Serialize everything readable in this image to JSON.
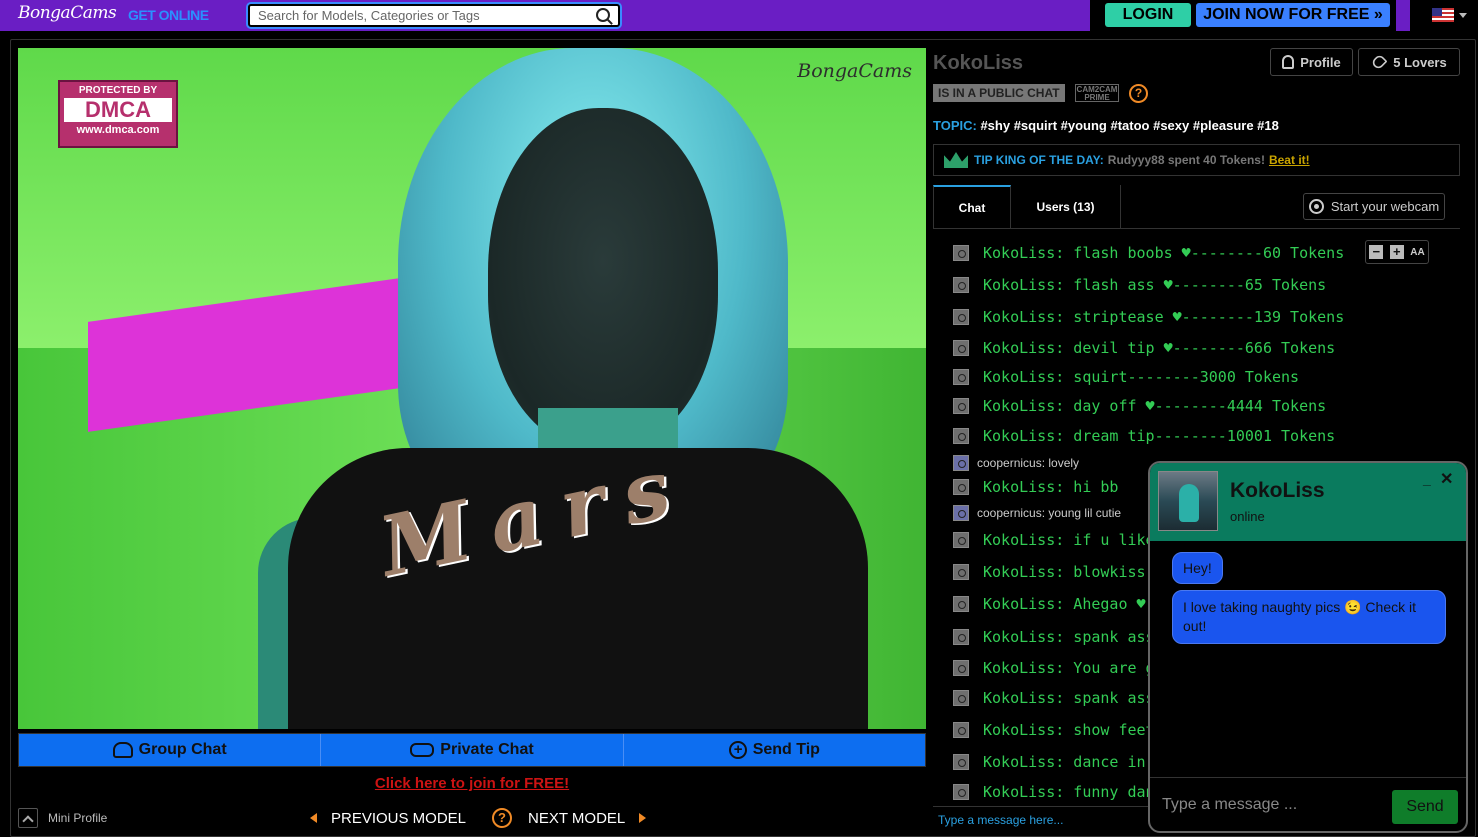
{
  "header": {
    "logo": "BongaCams",
    "online": "GET ONLINE",
    "search_placeholder": "Search for Models, Categories or Tags",
    "login": "LOGIN",
    "join": "JOIN NOW FOR FREE »"
  },
  "stream": {
    "dmca_protected": "PROTECTED BY",
    "dmca_big": "DMCA",
    "dmca_url": "www.dmca.com",
    "watermark": "BongaCams",
    "shirt_text": "Mars"
  },
  "controls": {
    "group_chat": "Group Chat",
    "private_chat": "Private Chat",
    "send_tip": "Send Tip",
    "join_free": "Click here to join for FREE!",
    "mini_profile": "Mini Profile",
    "previous_model": "PREVIOUS MODEL",
    "next_model": "NEXT MODEL",
    "help": "?"
  },
  "model": {
    "name": "KokoLiss",
    "profile": "Profile",
    "lovers": "5 Lovers",
    "status": "IS IN A PUBLIC CHAT",
    "prime": "CAM2CAM PRIME",
    "help": "?",
    "topic_label": "TOPIC:",
    "topic": "#shy #squirt #young #tatoo #sexy #pleasure #18"
  },
  "tipking": {
    "label": "TIP KING OF THE DAY:",
    "who": "Rudyyy88 spent 40 Tokens!",
    "beat": "Beat it!"
  },
  "tabs": {
    "chat": "Chat",
    "users": "Users (13)",
    "webcam": "Start your webcam"
  },
  "chat": {
    "zoom_minus": "−",
    "zoom_plus": "+",
    "zoom_label": "AA",
    "messages": [
      {
        "type": "model",
        "text": "KokoLiss: flash boobs ♥--------60 Tokens"
      },
      {
        "type": "model",
        "text": "KokoLiss: flash ass  ♥--------65 Tokens"
      },
      {
        "type": "model",
        "text": "KokoLiss: striptease ♥--------139 Tokens"
      },
      {
        "type": "model",
        "text": "KokoLiss: devil tip  ♥--------666 Tokens"
      },
      {
        "type": "model",
        "text": "KokoLiss: squirt--------3000 Tokens"
      },
      {
        "type": "model",
        "text": "KokoLiss: day off  ♥--------4444 Tokens"
      },
      {
        "type": "model",
        "text": "KokoLiss: dream tip--------10001 Tokens"
      },
      {
        "type": "user",
        "text": "coopernicus: lovely"
      },
      {
        "type": "model",
        "text": "KokoLiss: hi bb"
      },
      {
        "type": "user",
        "text": "coopernicus: young lil cutie"
      },
      {
        "type": "model",
        "text": "KokoLiss: if u like me"
      },
      {
        "type": "model",
        "text": "KokoLiss: blowkiss  []-"
      },
      {
        "type": "model",
        "text": "KokoLiss: Ahegao  ♥-"
      },
      {
        "type": "model",
        "text": "KokoLiss: spank ass  ♥"
      },
      {
        "type": "model",
        "text": "KokoLiss: You are gor"
      },
      {
        "type": "model",
        "text": "KokoLiss: spank ass x"
      },
      {
        "type": "model",
        "text": "KokoLiss: show feet"
      },
      {
        "type": "model",
        "text": "KokoLiss: dance in cl"
      },
      {
        "type": "model",
        "text": "KokoLiss: funny dance"
      }
    ],
    "input_placeholder": "Type a message here..."
  },
  "popup": {
    "name": "KokoLiss",
    "status": "online",
    "minimize": "_",
    "close": "✕",
    "bubble1": "Hey!",
    "bubble2": "I love taking naughty pics 😉 Check it out!",
    "input_placeholder": "Type a message ...",
    "send": "Send"
  },
  "colors": {
    "topbar": "#6a1ec4",
    "accent_blue": "#0d6ef0",
    "chat_green": "#33cc55",
    "popup_header": "#0a7b5e"
  }
}
